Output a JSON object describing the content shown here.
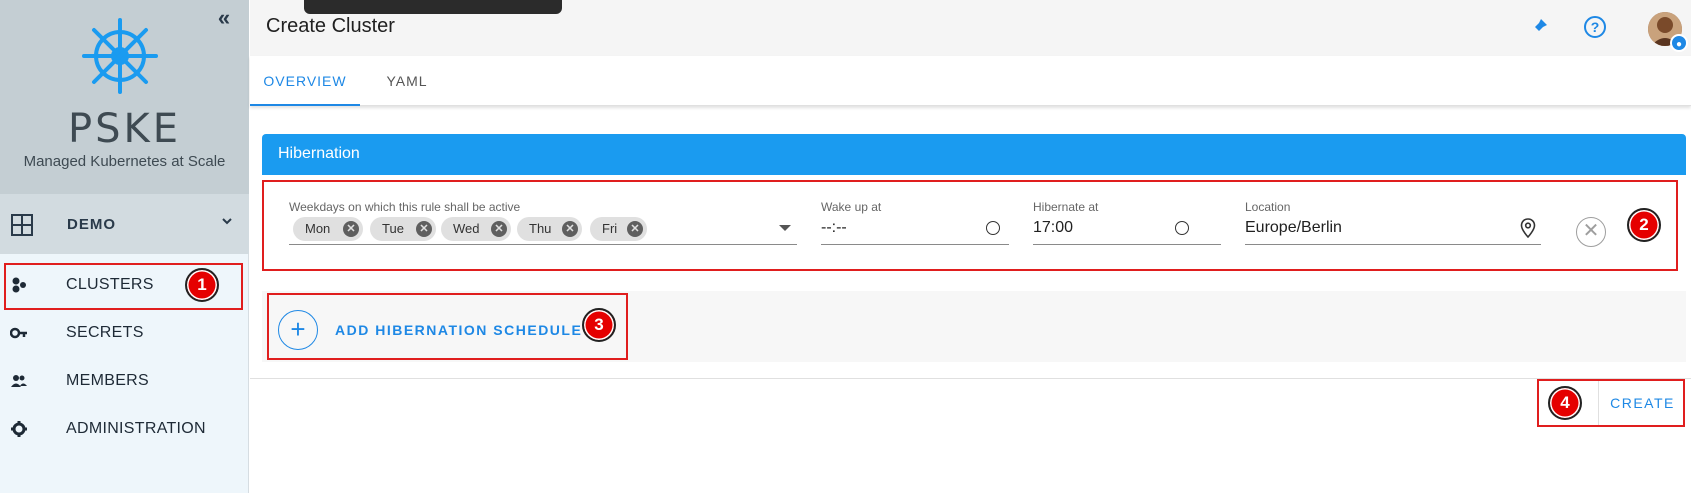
{
  "sidebar": {
    "brand_title": "PSKE",
    "brand_subtitle": "Managed Kubernetes at Scale",
    "project": "DEMO",
    "items": [
      {
        "label": "CLUSTERS",
        "icon": "clusters-icon"
      },
      {
        "label": "SECRETS",
        "icon": "key-icon"
      },
      {
        "label": "MEMBERS",
        "icon": "members-icon"
      },
      {
        "label": "ADMINISTRATION",
        "icon": "gear-icon"
      }
    ]
  },
  "header": {
    "title": "Create Cluster",
    "icons": [
      "pin-icon",
      "help-icon",
      "avatar"
    ]
  },
  "tabs": [
    {
      "label": "OVERVIEW",
      "active": true
    },
    {
      "label": "YAML",
      "active": false
    }
  ],
  "hibernation": {
    "section_title": "Hibernation",
    "weekdays_label": "Weekdays on which this rule shall be active",
    "weekdays": [
      "Mon",
      "Tue",
      "Wed",
      "Thu",
      "Fri"
    ],
    "wake_label": "Wake up at",
    "wake_value": "--:--",
    "hibernate_label": "Hibernate at",
    "hibernate_value": "17:00",
    "location_label": "Location",
    "location_value": "Europe/Berlin",
    "add_label": "ADD HIBERNATION SCHEDULE"
  },
  "actions": {
    "create_label": "CREATE"
  },
  "annotations": [
    "1",
    "2",
    "3",
    "4"
  ],
  "colors": {
    "accent": "#1e88e5",
    "section_header": "#1a9bf0",
    "annotation": "#e01e1e"
  }
}
